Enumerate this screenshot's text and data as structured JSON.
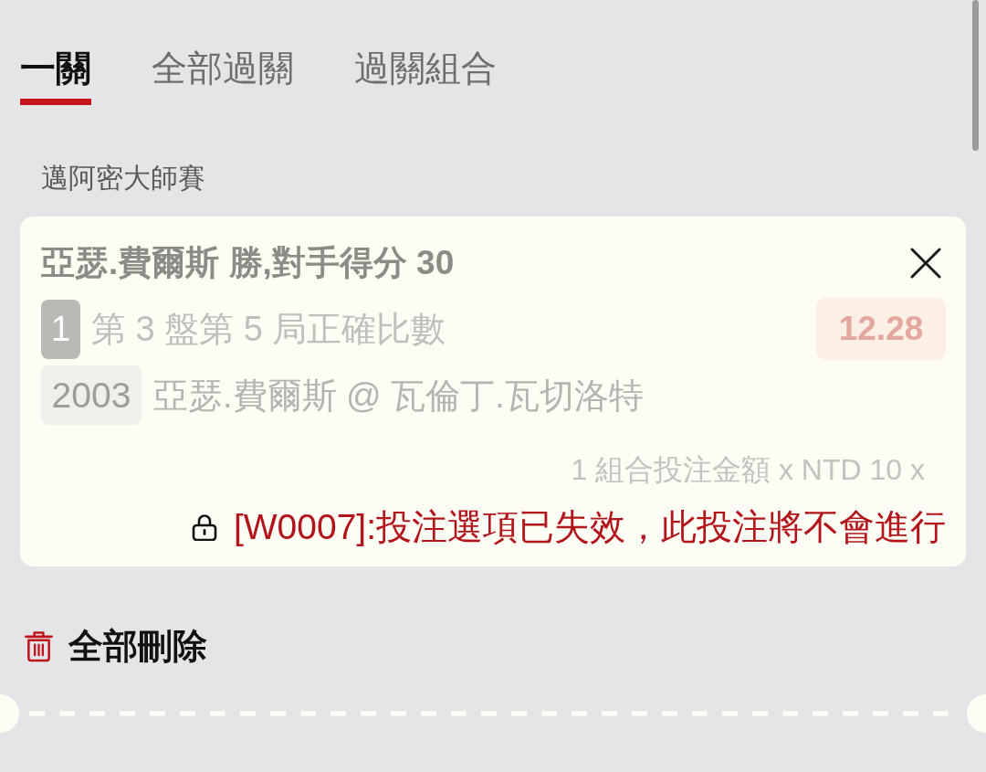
{
  "tabs": [
    {
      "label": "一關",
      "selected": true
    },
    {
      "label": "全部過關",
      "selected": false
    },
    {
      "label": "過關組合",
      "selected": false
    }
  ],
  "tournament": "邁阿密大師賽",
  "bet_slip": {
    "disabled": true,
    "selection": "亞瑟.費爾斯 勝,對手得分 30",
    "leg_number": "1",
    "market": "第 3 盤第 5 局正確比數",
    "odds": "12.28",
    "event_id": "2003",
    "event": "亞瑟.費爾斯 @ 瓦倫丁.瓦切洛特",
    "stake_summary": "1 組合投注金額 x NTD 10 x",
    "warning": "[W0007]:投注選項已失效，此投注將不會進行"
  },
  "delete_all": "全部刪除"
}
